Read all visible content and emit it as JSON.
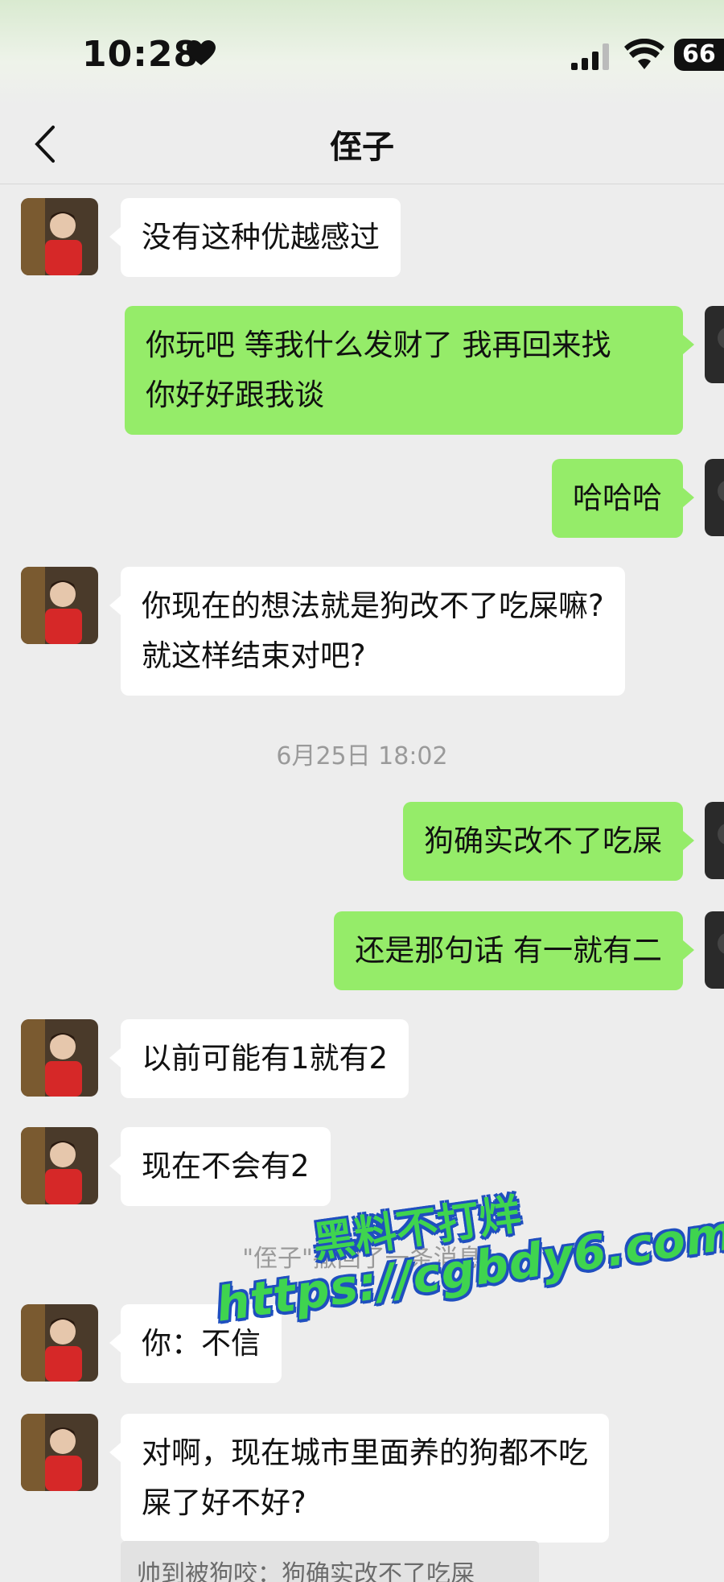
{
  "status_bar": {
    "time": "10:28",
    "battery": "66"
  },
  "header": {
    "title": "侄子"
  },
  "messages": [
    {
      "side": "in",
      "text": "没有这种优越感过"
    },
    {
      "side": "out",
      "text": "你玩吧  等我什么发财了 我再回来找\n你好好跟我谈"
    },
    {
      "side": "out",
      "text": "哈哈哈"
    },
    {
      "side": "in",
      "text": "你现在的想法就是狗改不了吃屎嘛?\n就这样结束对吧?"
    },
    {
      "side": "out",
      "text": "狗确实改不了吃屎"
    },
    {
      "side": "out",
      "text": "还是那句话 有一就有二"
    },
    {
      "side": "in",
      "text": "以前可能有1就有2"
    },
    {
      "side": "in",
      "text": "现在不会有2"
    },
    {
      "side": "in",
      "text": "你：不信"
    },
    {
      "side": "in",
      "text": "对啊，现在城市里面养的狗都不吃\n屎了好不好?"
    }
  ],
  "timestamp": "6月25日 18:02",
  "recall_notice": "\"侄子\"撤回了一条消息",
  "quote_text": "帅到被狗咬：狗确实改不了吃屎",
  "watermark": {
    "line1": "黑料不打烊",
    "line2": "https://cgbdy6.com"
  }
}
